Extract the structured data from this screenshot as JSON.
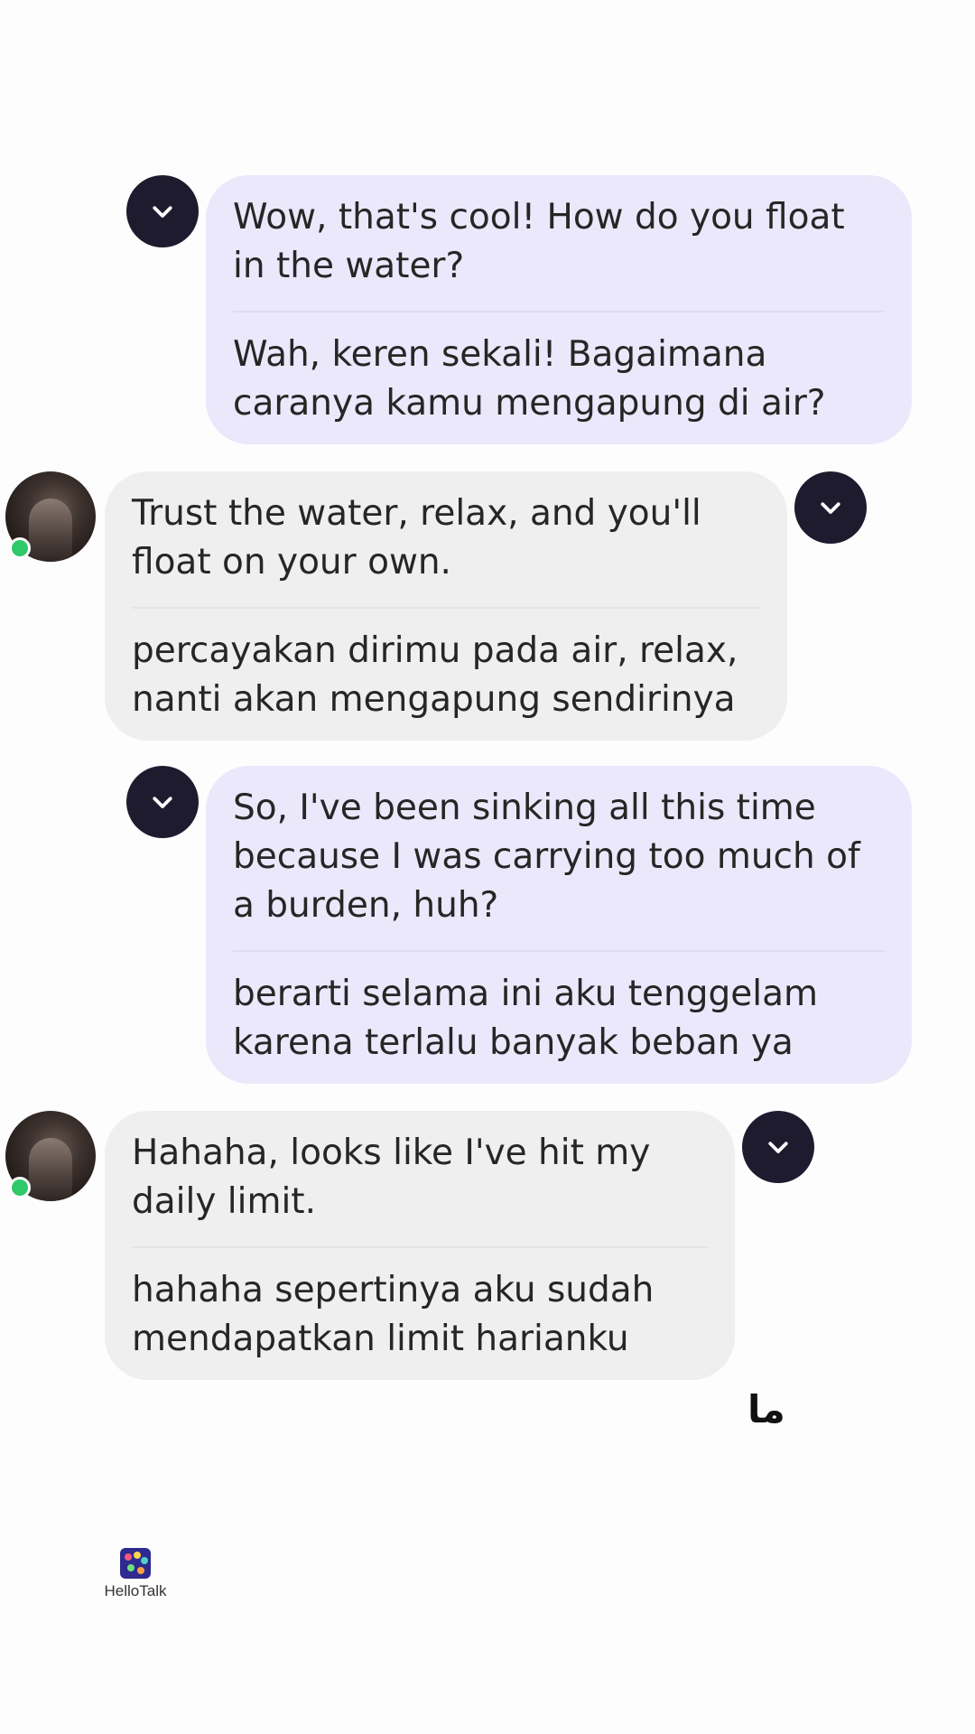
{
  "messages": [
    {
      "sender": "me",
      "original": "Wow, that's cool! How do you float in the water?",
      "translation": "Wah, keren sekali! Bagaimana caranya kamu mengapung di air?"
    },
    {
      "sender": "partner",
      "original": "Trust the water, relax, and you'll float on your own.",
      "translation": "percayakan dirimu pada air, relax, nanti akan mengapung sendirinya"
    },
    {
      "sender": "me",
      "original": "So, I've been sinking all this time because I was carrying too much of a burden, huh?",
      "translation": "berarti selama ini aku tenggelam karena terlalu banyak beban ya"
    },
    {
      "sender": "partner",
      "original": "Hahaha, looks like I've hit my daily limit.",
      "translation": "hahaha sepertinya aku sudah mendapatkan limit harianku"
    }
  ],
  "overlay_text": "ما",
  "watermark": {
    "name": "HelloTalk"
  },
  "icons": {
    "menu": "chevron-down-icon",
    "avatar": "user-avatar",
    "status": "online-status-dot"
  },
  "colors": {
    "sent_bubble": "#ebe8fb",
    "received_bubble": "#efefef",
    "menu_button": "#1e1b2e",
    "online": "#2fc969"
  }
}
